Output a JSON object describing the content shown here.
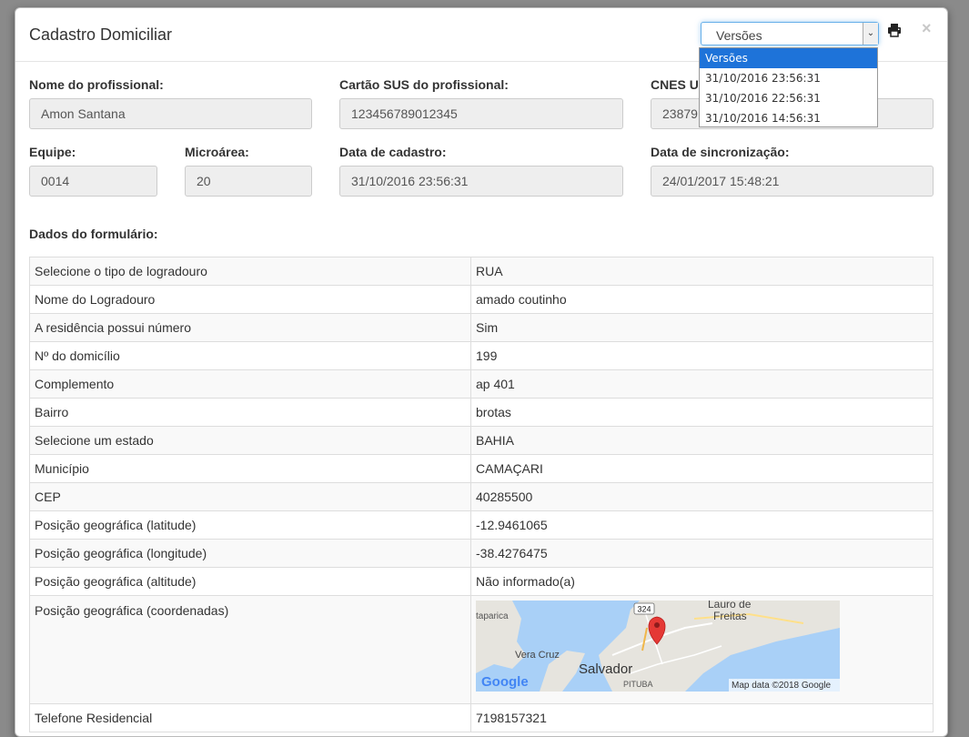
{
  "modal": {
    "title": "Cadastro Domiciliar",
    "versions": {
      "selected": "Versões",
      "options": [
        "Versões",
        "31/10/2016 23:56:31",
        "31/10/2016 22:56:31",
        "31/10/2016 14:56:31"
      ]
    },
    "close_label": "×"
  },
  "fields": {
    "nome_profissional": {
      "label": "Nome do profissional:",
      "value": "Amon Santana"
    },
    "cartao_sus": {
      "label": "Cartão SUS do profissional:",
      "value": "123456789012345"
    },
    "cnes": {
      "label": "CNES U",
      "value": "23879"
    },
    "equipe": {
      "label": "Equipe:",
      "value": "0014"
    },
    "microarea": {
      "label": "Microárea:",
      "value": "20"
    },
    "data_cadastro": {
      "label": "Data de cadastro:",
      "value": "31/10/2016 23:56:31"
    },
    "data_sincronizacao": {
      "label": "Data de sincronização:",
      "value": "24/01/2017 15:48:21"
    }
  },
  "form": {
    "section_title": "Dados do formulário:",
    "rows": [
      {
        "k": "Selecione o tipo de logradouro",
        "v": "RUA"
      },
      {
        "k": "Nome do Logradouro",
        "v": "amado coutinho"
      },
      {
        "k": "A residência possui número",
        "v": "Sim"
      },
      {
        "k": "Nº do domicílio",
        "v": "199"
      },
      {
        "k": "Complemento",
        "v": "ap 401"
      },
      {
        "k": "Bairro",
        "v": "brotas"
      },
      {
        "k": "Selecione um estado",
        "v": "BAHIA"
      },
      {
        "k": "Município",
        "v": "CAMAÇARI"
      },
      {
        "k": "CEP",
        "v": "40285500"
      },
      {
        "k": "Posição geográfica (latitude)",
        "v": "-12.9461065"
      },
      {
        "k": "Posição geográfica (longitude)",
        "v": "-38.4276475"
      },
      {
        "k": "Posição geográfica (altitude)",
        "v": "Não informado(a)"
      }
    ],
    "map_row": {
      "k": "Posição geográfica (coordenadas)",
      "map_labels": {
        "city": "Salvador",
        "lauro1": "Lauro de",
        "lauro2": "Freitas",
        "vera_cruz": "Vera Cruz",
        "itaparica": "taparica",
        "pituba": "PITUBA",
        "road": "324",
        "google": "Google",
        "attribution": "Map data ©2018 Google"
      }
    },
    "last_row": {
      "k": "Telefone Residencial",
      "v": "7198157321"
    }
  },
  "colors": {
    "accent": "#1e73d9",
    "map_water": "#a9d0f7",
    "map_land": "#e6e4de",
    "pin": "#e53935"
  }
}
